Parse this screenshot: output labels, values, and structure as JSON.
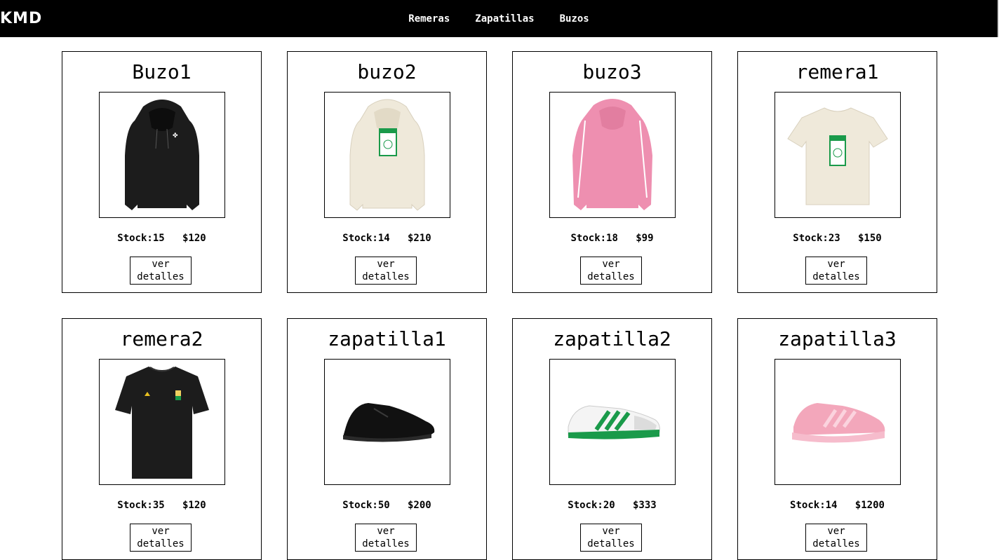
{
  "brand": "KMD",
  "nav": [
    "Remeras",
    "Zapatillas",
    "Buzos"
  ],
  "details_button": {
    "line1": "ver",
    "line2": "detalles"
  },
  "products": [
    {
      "name": "Buzo1",
      "stock": "Stock:15",
      "price": "$120",
      "image": "black-hoodie",
      "color": "#1c1c1c"
    },
    {
      "name": "buzo2",
      "stock": "Stock:14",
      "price": "$210",
      "image": "cream-hoodie",
      "color": "#efe9da"
    },
    {
      "name": "buzo3",
      "stock": "Stock:18",
      "price": "$99",
      "image": "pink-hoodie",
      "color": "#ee8fb0"
    },
    {
      "name": "remera1",
      "stock": "Stock:23",
      "price": "$150",
      "image": "cream-tshirt",
      "color": "#efe9da"
    },
    {
      "name": "remera2",
      "stock": "Stock:35",
      "price": "$120",
      "image": "black-tshirt",
      "color": "#1c1c1c"
    },
    {
      "name": "zapatilla1",
      "stock": "Stock:50",
      "price": "$200",
      "image": "black-sneaker",
      "color": "#111111"
    },
    {
      "name": "zapatilla2",
      "stock": "Stock:20",
      "price": "$333",
      "image": "white-green-sneaker",
      "color": "#1a9a4a"
    },
    {
      "name": "zapatilla3",
      "stock": "Stock:14",
      "price": "$1200",
      "image": "pink-sneaker",
      "color": "#f3a7bb"
    }
  ]
}
